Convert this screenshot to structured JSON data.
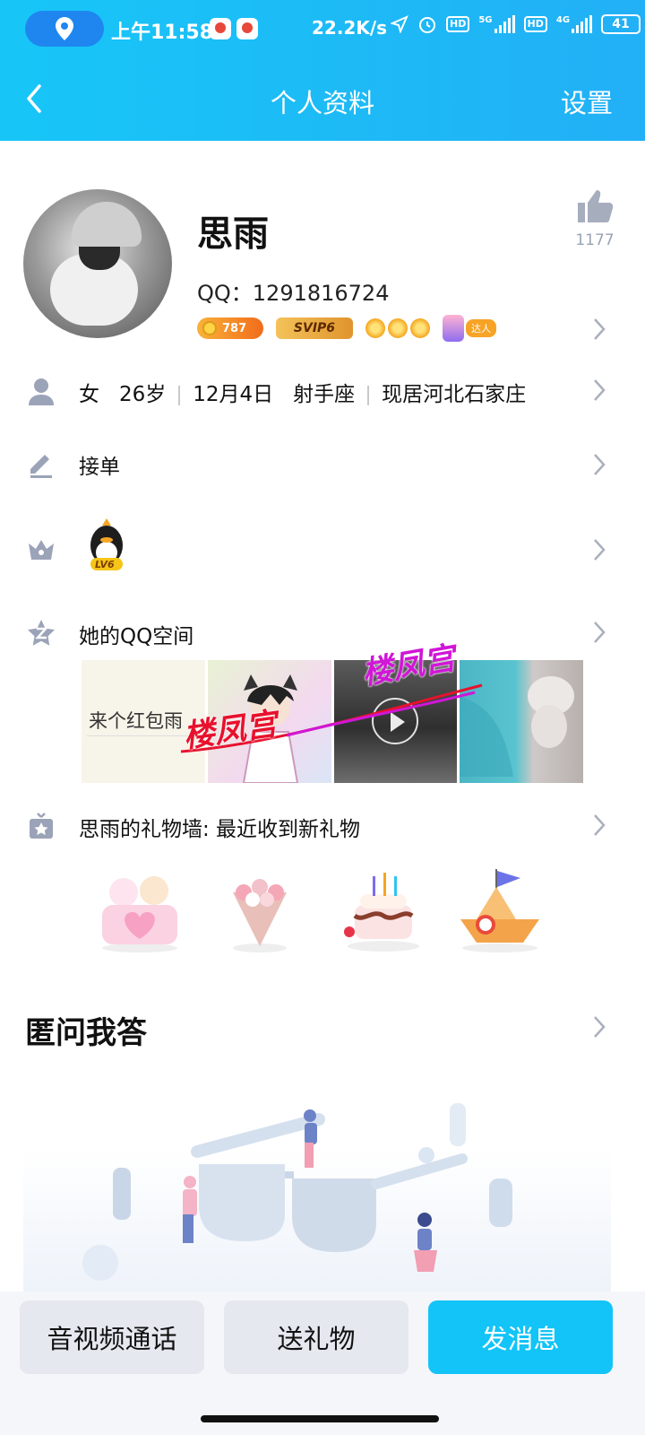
{
  "status_bar": {
    "time": "上午11:58",
    "net_speed": "22.2K/s",
    "hd1": "HD",
    "net1": "5G",
    "hd2": "HD",
    "net2": "4G",
    "battery": "41"
  },
  "nav": {
    "title": "个人资料",
    "right_label": "设置"
  },
  "profile": {
    "name": "思雨",
    "qq": "QQ：1291816724",
    "level_badge": "787",
    "svip_badge": "SVIP6",
    "daren_badge": "达人",
    "like_count": "1177"
  },
  "rows": {
    "info": {
      "gender": "女",
      "age": "26岁",
      "birthday": "12月4日",
      "zodiac": "射手座",
      "location": "现居河北石家庄"
    },
    "sign": "接单",
    "qzone": "她的QQ空间",
    "qzone_post_text": "来个红包雨",
    "gift_wall": "思雨的礼物墙: 最近收到新礼物"
  },
  "level_icon_label": "LV6",
  "watermark": "楼凤宫",
  "anon_section": {
    "title": "匿问我答"
  },
  "bottom_bar": {
    "call_label": "音视频通话",
    "gift_label": "送礼物",
    "message_label": "发消息"
  },
  "colors": {
    "header": "#17c6f7",
    "primary_button": "#12c4f7",
    "secondary_button": "#e6e8f0",
    "watermark_red": "#e8112d",
    "watermark_purple": "#d016d6"
  }
}
